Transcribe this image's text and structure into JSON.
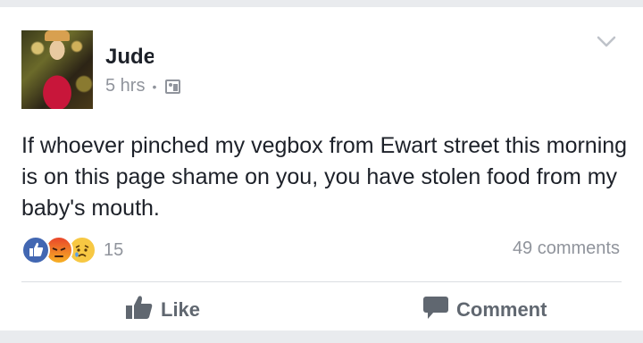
{
  "post": {
    "author_name": "Jude",
    "time_ago": "5 hrs",
    "separator": "•",
    "audience_icon": "friends-icon",
    "text": "If whoever pinched my vegbox from Ewart street this morning is on this page shame on you, you have stolen food from my baby's mouth.",
    "reactions": {
      "types": [
        "like",
        "angry",
        "sad"
      ],
      "count": "15"
    },
    "comments_count": "49 comments"
  },
  "actions": {
    "like_label": "Like",
    "comment_label": "Comment"
  },
  "colors": {
    "background": "#e9ebee",
    "card": "#ffffff",
    "text": "#1d2129",
    "muted": "#90949c",
    "action": "#606770",
    "like_blue": "#4267b2"
  }
}
